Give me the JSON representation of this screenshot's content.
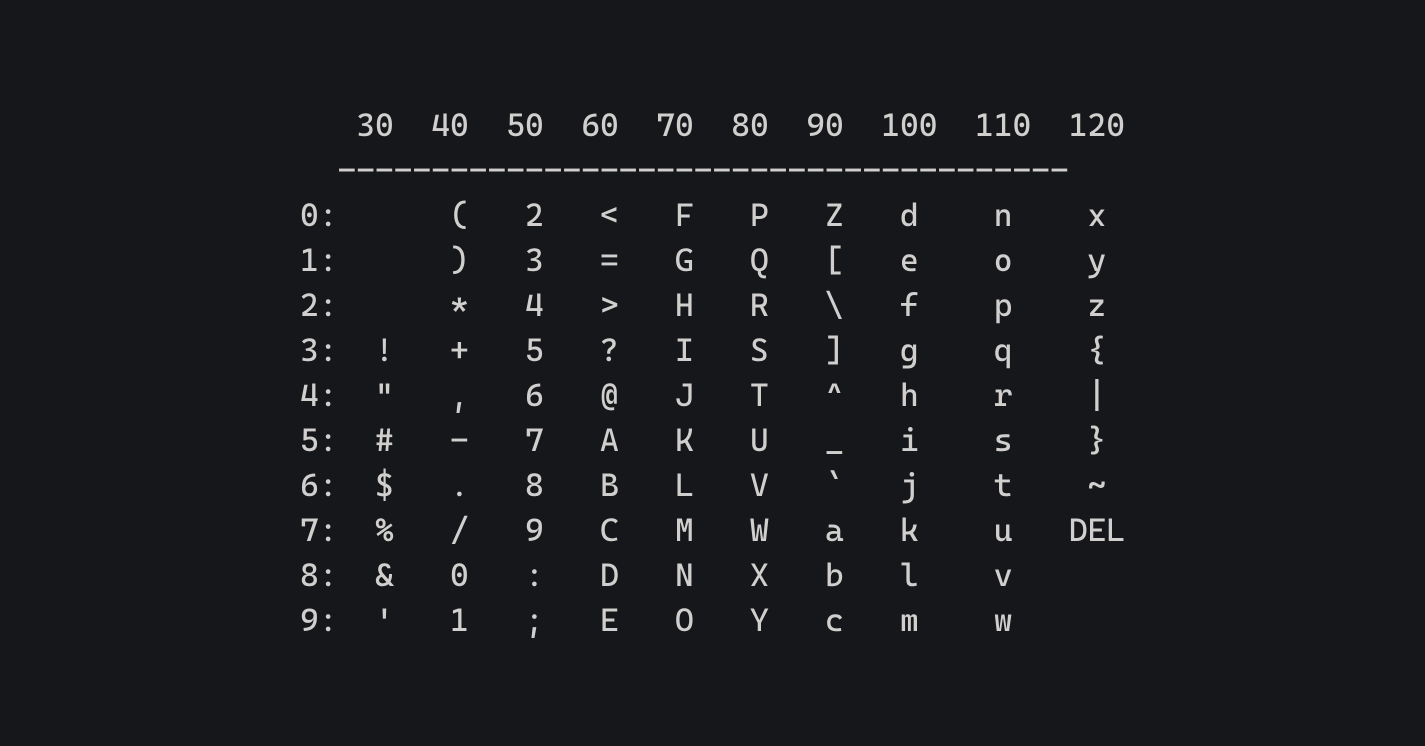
{
  "chart_data": {
    "type": "table",
    "title": "",
    "columns": [
      "30",
      "40",
      "50",
      "60",
      "70",
      "80",
      "90",
      "100",
      "110",
      "120"
    ],
    "row_labels": [
      "0:",
      "1:",
      "2:",
      "3:",
      "4:",
      "5:",
      "6:",
      "7:",
      "8:",
      "9:"
    ],
    "rows": [
      [
        "",
        "(",
        "2",
        "<",
        "F",
        "P",
        "Z",
        "d",
        "n",
        "x"
      ],
      [
        "",
        ")",
        "3",
        "=",
        "G",
        "Q",
        "[",
        "e",
        "o",
        "y"
      ],
      [
        "",
        "*",
        "4",
        ">",
        "H",
        "R",
        "\\",
        "f",
        "p",
        "z"
      ],
      [
        "!",
        "+",
        "5",
        "?",
        "I",
        "S",
        "]",
        "g",
        "q",
        "{"
      ],
      [
        "\"",
        ",",
        "6",
        "@",
        "J",
        "T",
        "^",
        "h",
        "r",
        "|"
      ],
      [
        "#",
        "-",
        "7",
        "A",
        "K",
        "U",
        "_",
        "i",
        "s",
        "}"
      ],
      [
        "$",
        ".",
        "8",
        "B",
        "L",
        "V",
        "`",
        "j",
        "t",
        "~"
      ],
      [
        "%",
        "/",
        "9",
        "C",
        "M",
        "W",
        "a",
        "k",
        "u",
        "DEL"
      ],
      [
        "&",
        "0",
        ":",
        "D",
        "N",
        "X",
        "b",
        "l",
        "v",
        ""
      ],
      [
        "'",
        "1",
        ";",
        "E",
        "O",
        "Y",
        "c",
        "m",
        "w",
        ""
      ]
    ],
    "divider": "---------------------------------------"
  },
  "render": {
    "header_prefix": "   ",
    "col_spacing_narrow": "  ",
    "col_spacing_wide": "   ",
    "divider_prefix": "  "
  }
}
